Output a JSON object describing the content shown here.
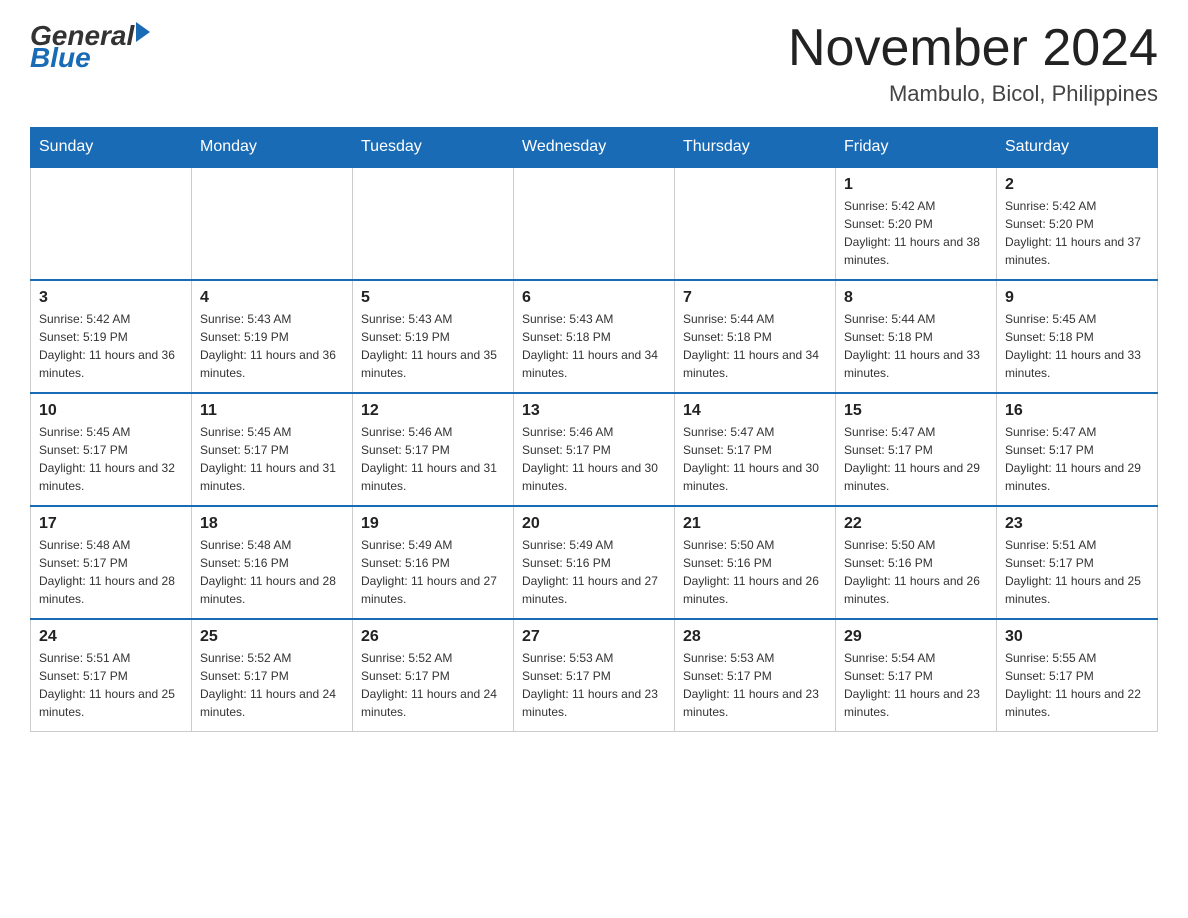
{
  "header": {
    "logo": {
      "general_text": "General",
      "blue_text": "Blue"
    },
    "title": "November 2024",
    "subtitle": "Mambulo, Bicol, Philippines"
  },
  "days_of_week": [
    "Sunday",
    "Monday",
    "Tuesday",
    "Wednesday",
    "Thursday",
    "Friday",
    "Saturday"
  ],
  "weeks": [
    {
      "days": [
        {
          "number": "",
          "info": ""
        },
        {
          "number": "",
          "info": ""
        },
        {
          "number": "",
          "info": ""
        },
        {
          "number": "",
          "info": ""
        },
        {
          "number": "",
          "info": ""
        },
        {
          "number": "1",
          "info": "Sunrise: 5:42 AM\nSunset: 5:20 PM\nDaylight: 11 hours and 38 minutes."
        },
        {
          "number": "2",
          "info": "Sunrise: 5:42 AM\nSunset: 5:20 PM\nDaylight: 11 hours and 37 minutes."
        }
      ]
    },
    {
      "days": [
        {
          "number": "3",
          "info": "Sunrise: 5:42 AM\nSunset: 5:19 PM\nDaylight: 11 hours and 36 minutes."
        },
        {
          "number": "4",
          "info": "Sunrise: 5:43 AM\nSunset: 5:19 PM\nDaylight: 11 hours and 36 minutes."
        },
        {
          "number": "5",
          "info": "Sunrise: 5:43 AM\nSunset: 5:19 PM\nDaylight: 11 hours and 35 minutes."
        },
        {
          "number": "6",
          "info": "Sunrise: 5:43 AM\nSunset: 5:18 PM\nDaylight: 11 hours and 34 minutes."
        },
        {
          "number": "7",
          "info": "Sunrise: 5:44 AM\nSunset: 5:18 PM\nDaylight: 11 hours and 34 minutes."
        },
        {
          "number": "8",
          "info": "Sunrise: 5:44 AM\nSunset: 5:18 PM\nDaylight: 11 hours and 33 minutes."
        },
        {
          "number": "9",
          "info": "Sunrise: 5:45 AM\nSunset: 5:18 PM\nDaylight: 11 hours and 33 minutes."
        }
      ]
    },
    {
      "days": [
        {
          "number": "10",
          "info": "Sunrise: 5:45 AM\nSunset: 5:17 PM\nDaylight: 11 hours and 32 minutes."
        },
        {
          "number": "11",
          "info": "Sunrise: 5:45 AM\nSunset: 5:17 PM\nDaylight: 11 hours and 31 minutes."
        },
        {
          "number": "12",
          "info": "Sunrise: 5:46 AM\nSunset: 5:17 PM\nDaylight: 11 hours and 31 minutes."
        },
        {
          "number": "13",
          "info": "Sunrise: 5:46 AM\nSunset: 5:17 PM\nDaylight: 11 hours and 30 minutes."
        },
        {
          "number": "14",
          "info": "Sunrise: 5:47 AM\nSunset: 5:17 PM\nDaylight: 11 hours and 30 minutes."
        },
        {
          "number": "15",
          "info": "Sunrise: 5:47 AM\nSunset: 5:17 PM\nDaylight: 11 hours and 29 minutes."
        },
        {
          "number": "16",
          "info": "Sunrise: 5:47 AM\nSunset: 5:17 PM\nDaylight: 11 hours and 29 minutes."
        }
      ]
    },
    {
      "days": [
        {
          "number": "17",
          "info": "Sunrise: 5:48 AM\nSunset: 5:17 PM\nDaylight: 11 hours and 28 minutes."
        },
        {
          "number": "18",
          "info": "Sunrise: 5:48 AM\nSunset: 5:16 PM\nDaylight: 11 hours and 28 minutes."
        },
        {
          "number": "19",
          "info": "Sunrise: 5:49 AM\nSunset: 5:16 PM\nDaylight: 11 hours and 27 minutes."
        },
        {
          "number": "20",
          "info": "Sunrise: 5:49 AM\nSunset: 5:16 PM\nDaylight: 11 hours and 27 minutes."
        },
        {
          "number": "21",
          "info": "Sunrise: 5:50 AM\nSunset: 5:16 PM\nDaylight: 11 hours and 26 minutes."
        },
        {
          "number": "22",
          "info": "Sunrise: 5:50 AM\nSunset: 5:16 PM\nDaylight: 11 hours and 26 minutes."
        },
        {
          "number": "23",
          "info": "Sunrise: 5:51 AM\nSunset: 5:17 PM\nDaylight: 11 hours and 25 minutes."
        }
      ]
    },
    {
      "days": [
        {
          "number": "24",
          "info": "Sunrise: 5:51 AM\nSunset: 5:17 PM\nDaylight: 11 hours and 25 minutes."
        },
        {
          "number": "25",
          "info": "Sunrise: 5:52 AM\nSunset: 5:17 PM\nDaylight: 11 hours and 24 minutes."
        },
        {
          "number": "26",
          "info": "Sunrise: 5:52 AM\nSunset: 5:17 PM\nDaylight: 11 hours and 24 minutes."
        },
        {
          "number": "27",
          "info": "Sunrise: 5:53 AM\nSunset: 5:17 PM\nDaylight: 11 hours and 23 minutes."
        },
        {
          "number": "28",
          "info": "Sunrise: 5:53 AM\nSunset: 5:17 PM\nDaylight: 11 hours and 23 minutes."
        },
        {
          "number": "29",
          "info": "Sunrise: 5:54 AM\nSunset: 5:17 PM\nDaylight: 11 hours and 23 minutes."
        },
        {
          "number": "30",
          "info": "Sunrise: 5:55 AM\nSunset: 5:17 PM\nDaylight: 11 hours and 22 minutes."
        }
      ]
    }
  ]
}
